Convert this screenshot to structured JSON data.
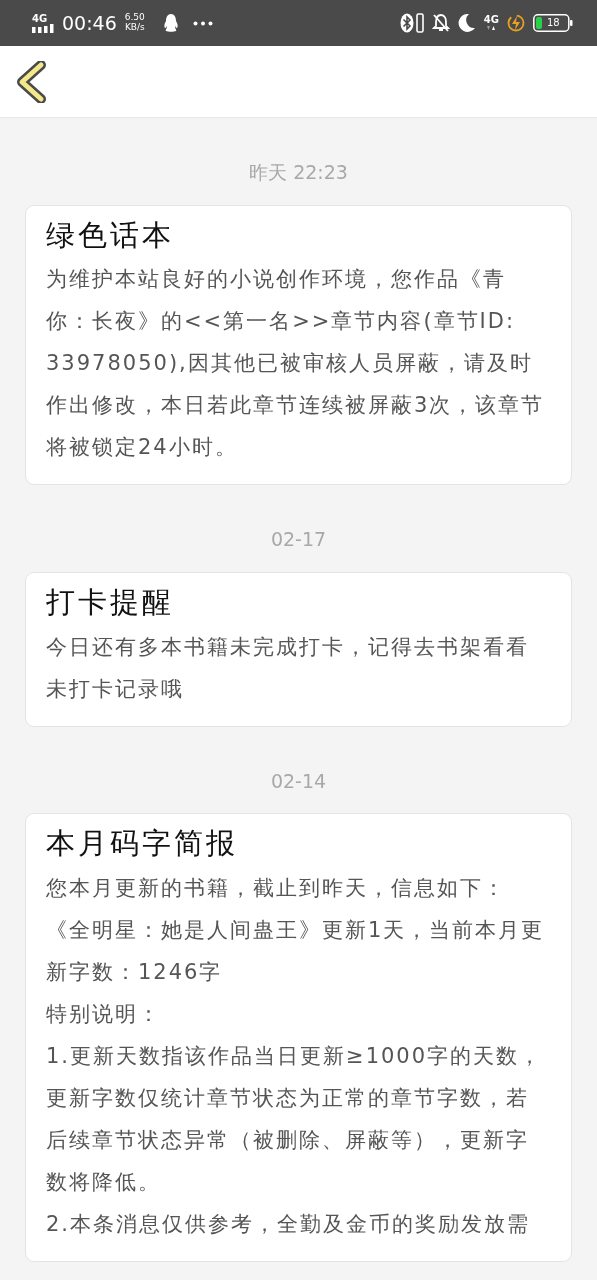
{
  "status_bar": {
    "network": "4G",
    "time": "00:46",
    "speed": "6.50",
    "speed_unit": "KB/s",
    "data_network": "4G",
    "battery": "18"
  },
  "messages": [
    {
      "date": "昨天 22:23",
      "title": "绿色话本",
      "paragraphs": [
        "为维护本站良好的小说创作环境，您作品《青你：长夜》的<<第一名>>章节内容(章节ID: 33978050),因其他已被审核人员屏蔽，请及时作出修改，本日若此章节连续被屏蔽3次，该章节将被锁定24小时。"
      ]
    },
    {
      "date": "02-17",
      "title": "打卡提醒",
      "paragraphs": [
        "今日还有多本书籍未完成打卡，记得去书架看看未打卡记录哦"
      ]
    },
    {
      "date": "02-14",
      "title": "本月码字简报",
      "paragraphs": [
        "您本月更新的书籍，截止到昨天，信息如下：",
        "《全明星：她是人间蛊王》更新1天，当前本月更新字数：1246字",
        "特别说明：",
        "1.更新天数指该作品当日更新≥1000字的天数，更新字数仅统计章节状态为正常的章节字数，若后续章节状态异常（被删除、屏蔽等），更新字数将降低。",
        "2.本条消息仅供参考，全勤及金币的奖励发放需"
      ]
    }
  ]
}
